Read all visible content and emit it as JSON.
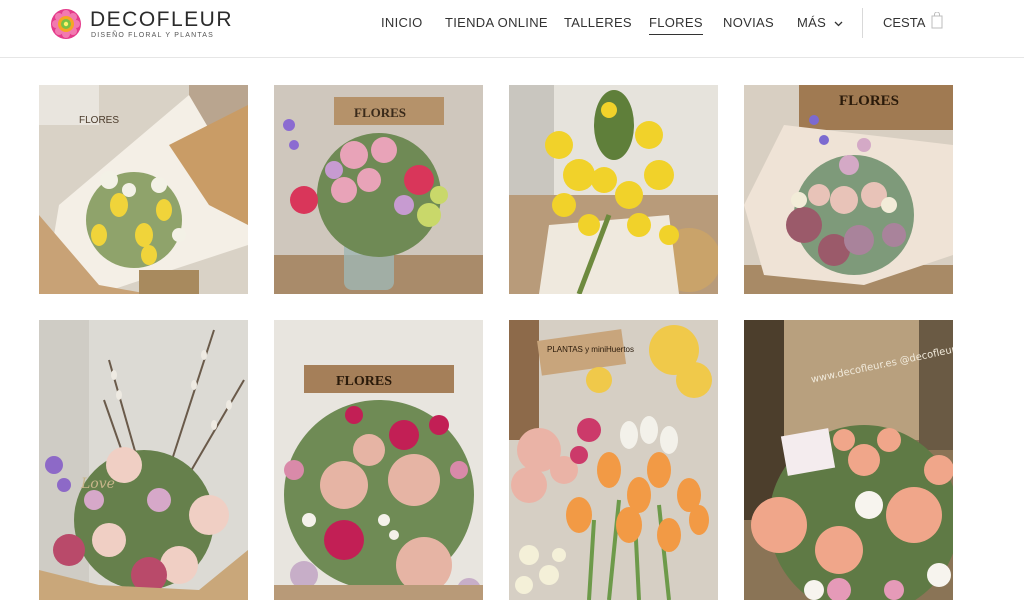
{
  "brand": {
    "name": "DECOFLEUR",
    "tagline": "DISEÑO FLORAL Y PLANTAS"
  },
  "nav": {
    "items": [
      {
        "label": "INICIO",
        "active": false
      },
      {
        "label": "TIENDA ONLINE",
        "active": false
      },
      {
        "label": "TALLERES",
        "active": false
      },
      {
        "label": "FLORES",
        "active": true
      },
      {
        "label": "NOVIAS",
        "active": false
      },
      {
        "label": "MÁS",
        "active": false,
        "has_dropdown": true
      }
    ],
    "cart_label": "CESTA",
    "icons": [
      "chevron-down-icon",
      "shopping-bag-icon"
    ]
  },
  "gallery": {
    "photos": [
      {
        "subject": "bouquet-yellow-tulips-lisianthus",
        "sign_text": "FLORES"
      },
      {
        "subject": "vase-pink-roses-daisies",
        "sign_text": "FLORES"
      },
      {
        "subject": "mimosa-bouquet",
        "sign_text": ""
      },
      {
        "subject": "bouquet-hydrangea-roses-eucalyptus",
        "sign_text": "FLORES"
      },
      {
        "subject": "arrangement-willow-roses-love",
        "sign_text": "Love"
      },
      {
        "subject": "bouquet-peach-roses-magenta",
        "sign_text": "FLORES"
      },
      {
        "subject": "tulips-plantas-sign",
        "sign_text": "PLANTAS y miniHuertos"
      },
      {
        "subject": "peach-roses-window",
        "sign_text": "www.decofleur.es @decofleur.es"
      }
    ]
  },
  "colors": {
    "text": "#333333",
    "divider": "#e6e6e6",
    "logo_outer": "#e43b8b",
    "logo_inner": "#7ac143"
  }
}
